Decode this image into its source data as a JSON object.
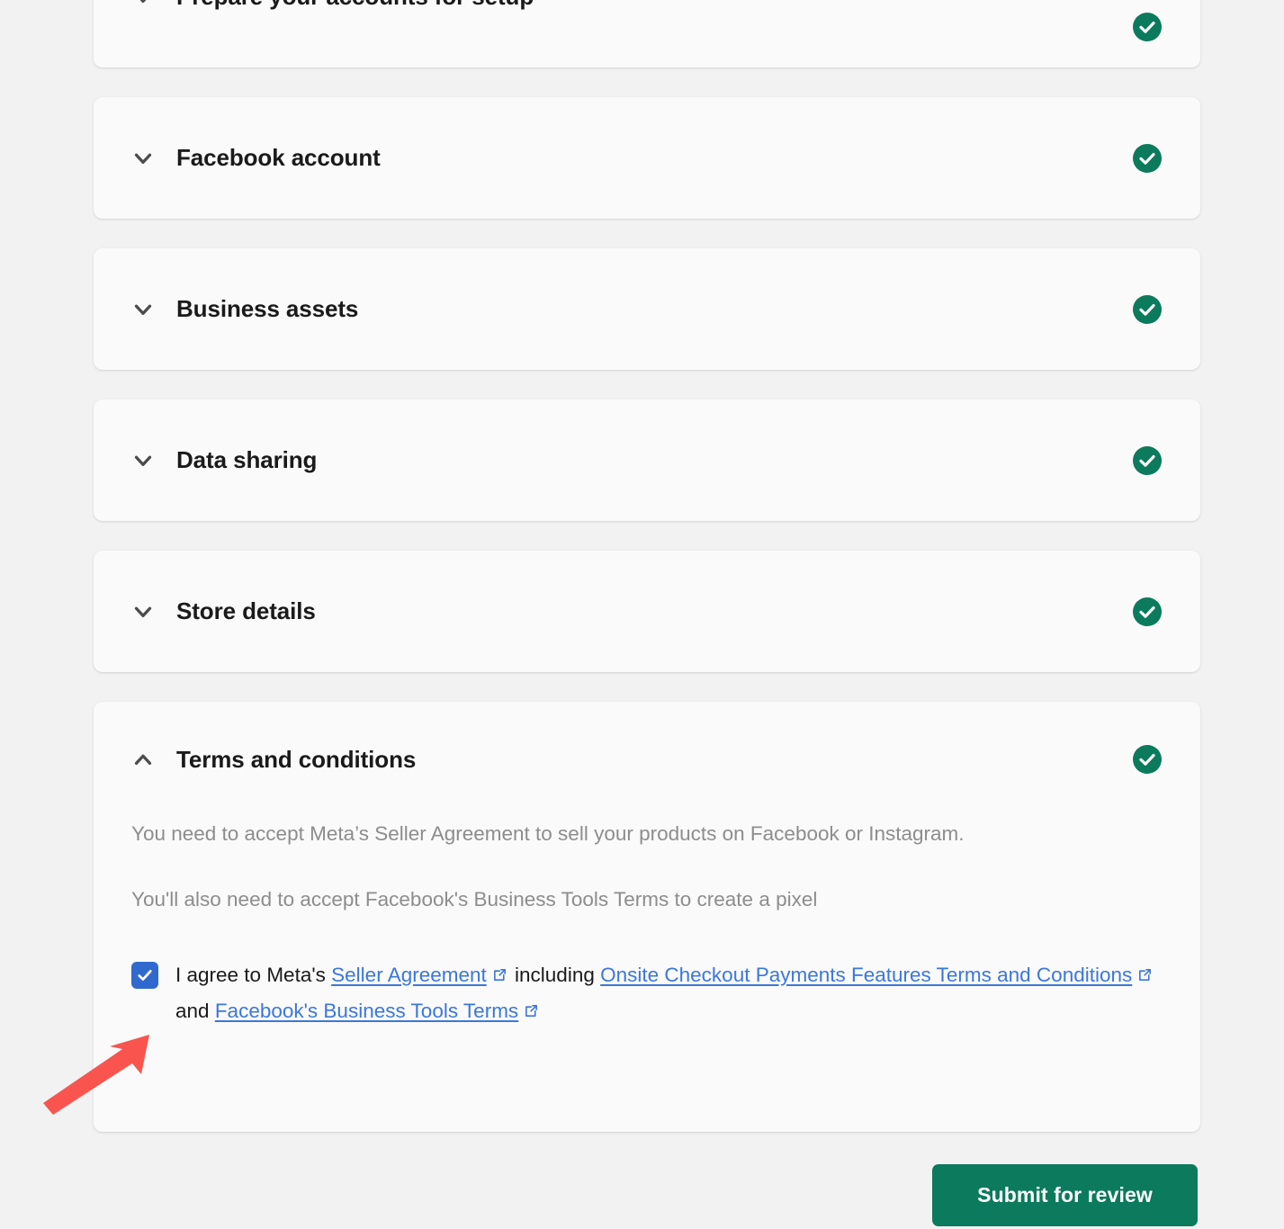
{
  "colors": {
    "page_background": "#f2f2f2",
    "card_background": "#fafafa",
    "success_green": "#0c7a5c",
    "checkbox_blue": "#3069ce",
    "link_blue": "#3b77dc",
    "annotation_red": "#f9554e",
    "heading_text": "#1a1a1a",
    "body_text": "#8d8d8d"
  },
  "sections": [
    {
      "id": "prepare",
      "title": "Prepare your accounts for setup",
      "chevron": "chevron-down-icon",
      "expanded": false,
      "status": "complete"
    },
    {
      "id": "facebook",
      "title": "Facebook account",
      "chevron": "chevron-down-icon",
      "expanded": false,
      "status": "complete"
    },
    {
      "id": "assets",
      "title": "Business assets",
      "chevron": "chevron-down-icon",
      "expanded": false,
      "status": "complete"
    },
    {
      "id": "data",
      "title": "Data sharing",
      "chevron": "chevron-down-icon",
      "expanded": false,
      "status": "complete"
    },
    {
      "id": "store",
      "title": "Store details",
      "chevron": "chevron-down-icon",
      "expanded": false,
      "status": "complete"
    },
    {
      "id": "terms",
      "title": "Terms and conditions",
      "chevron": "chevron-up-icon",
      "expanded": true,
      "status": "complete"
    }
  ],
  "terms": {
    "paragraph_1": "You need to accept Meta’s Seller Agreement to sell your products on Facebook or Instagram.",
    "paragraph_2": "You'll also need to accept Facebook's Business Tools Terms to create a pixel",
    "agreement": {
      "checked": true,
      "prefix": "I agree to Meta's",
      "link_1": "Seller Agreement",
      "middle": "including",
      "link_2": "Onsite Checkout Payments Features Terms and Conditions",
      "conjunction": "and",
      "link_3": "Facebook's Business Tools Terms",
      "external_link_icon": "external-link-icon"
    }
  },
  "footer": {
    "submit_label": "Submit for review"
  },
  "annotation": {
    "type": "arrow",
    "points_to": "agreement-checkbox",
    "color": "#f9554e"
  }
}
